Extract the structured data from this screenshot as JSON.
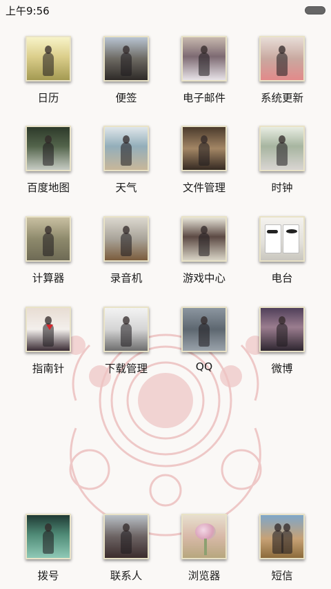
{
  "status_bar": {
    "time": "上午9:56"
  },
  "apps": [
    {
      "id": "calendar",
      "label": "日历",
      "icon": "girl-in-sunlit-field-icon",
      "bg": "linear-gradient(180deg,#f7f3c8 0%,#dccf8c 45%,#a49a52 100%)"
    },
    {
      "id": "notes",
      "label": "便签",
      "icon": "girl-by-train-icon",
      "bg": "linear-gradient(180deg,#b8c4d2 0%,#6d6a63 50%,#2e2a27 100%)"
    },
    {
      "id": "email",
      "label": "电子邮件",
      "icon": "girl-with-pigtails-icon",
      "bg": "linear-gradient(180deg,#c7b8ae 0%,#7d6a72 45%,#e8e3e8 100%)"
    },
    {
      "id": "system-update",
      "label": "系统更新",
      "icon": "girl-with-long-hair-icon",
      "bg": "linear-gradient(180deg,#e8ddd7 0%,#c9a9a0 50%,#e28a8a 100%)"
    },
    {
      "id": "baidu-map",
      "label": "百度地图",
      "icon": "girl-on-balcony-icon",
      "bg": "linear-gradient(180deg,#2d3a2a 0%,#53644b 45%,#c7ccc4 100%)"
    },
    {
      "id": "weather",
      "label": "天气",
      "icon": "girl-on-beach-icon",
      "bg": "linear-gradient(180deg,#dfe6ea 0%,#93aeba 45%,#c8b79a 100%)"
    },
    {
      "id": "file-manager",
      "label": "文件管理",
      "icon": "girl-hair-profile-icon",
      "bg": "linear-gradient(180deg,#4b3b2c 0%,#a38665 50%,#352a22 100%)"
    },
    {
      "id": "clock",
      "label": "时钟",
      "icon": "girl-in-garden-icon",
      "bg": "linear-gradient(180deg,#e8ede2 0%,#a7b5a0 45%,#d9d5d2 100%)"
    },
    {
      "id": "calculator",
      "label": "计算器",
      "icon": "girl-in-forest-icon",
      "bg": "linear-gradient(180deg,#c9c0a2 0%,#8e8a6c 50%,#6e6a55 100%)"
    },
    {
      "id": "recorder",
      "label": "录音机",
      "icon": "girl-at-easel-icon",
      "bg": "linear-gradient(180deg,#dcd8cf 0%,#a9a49a 50%,#7b5c3c 100%)"
    },
    {
      "id": "game-center",
      "label": "游戏中心",
      "icon": "girl-long-hair-back-icon",
      "bg": "linear-gradient(180deg,#e7e4d8 0%,#5c4a44 45%,#d9d4c6 100%)"
    },
    {
      "id": "radio",
      "label": "电台",
      "icon": "mr-mrs-mugs-icon",
      "bg": "linear-gradient(180deg,#f4f2ee 0%,#e2e0da 60%,#c9c6be 100%)"
    },
    {
      "id": "compass",
      "label": "指南针",
      "icon": "girl-superman-shirt-icon",
      "bg": "linear-gradient(180deg,#e8ddd3 0%,#f3efec 50%,#3a2c34 100%)"
    },
    {
      "id": "download-manager",
      "label": "下载管理",
      "icon": "girl-writing-on-wall-icon",
      "bg": "linear-gradient(180deg,#f3f3f3 0%,#d5d5d5 50%,#6d6d6d 100%)"
    },
    {
      "id": "qq",
      "label": "QQ",
      "icon": "girl-by-wall-icon",
      "bg": "linear-gradient(180deg,#8c96a0 0%,#5d6770 50%,#9aa3ab 100%)"
    },
    {
      "id": "weibo",
      "label": "微博",
      "icon": "girl-in-hat-icon",
      "bg": "linear-gradient(180deg,#50405a 0%,#9b7d8f 45%,#2e2630 100%)"
    }
  ],
  "dock": [
    {
      "id": "dialer",
      "label": "拨号",
      "icon": "girl-night-street-icon",
      "bg": "linear-gradient(180deg,#1f3a34 0%,#4f8a76 45%,#8fc9b6 100%)"
    },
    {
      "id": "contacts",
      "label": "联系人",
      "icon": "girl-in-window-icon",
      "bg": "linear-gradient(180deg,#b9c0c7 0%,#6c6363 50%,#3c2d2d 100%)"
    },
    {
      "id": "browser",
      "label": "浏览器",
      "icon": "flower-bouquet-icon",
      "bg": "linear-gradient(180deg,#e7dfce 0%,#d8b9a8 50%,#b7a77e 100%)"
    },
    {
      "id": "sms",
      "label": "短信",
      "icon": "couple-in-field-icon",
      "bg": "linear-gradient(180deg,#7fa6c8 0%,#c7a276 55%,#8c6b3b 100%)"
    }
  ]
}
